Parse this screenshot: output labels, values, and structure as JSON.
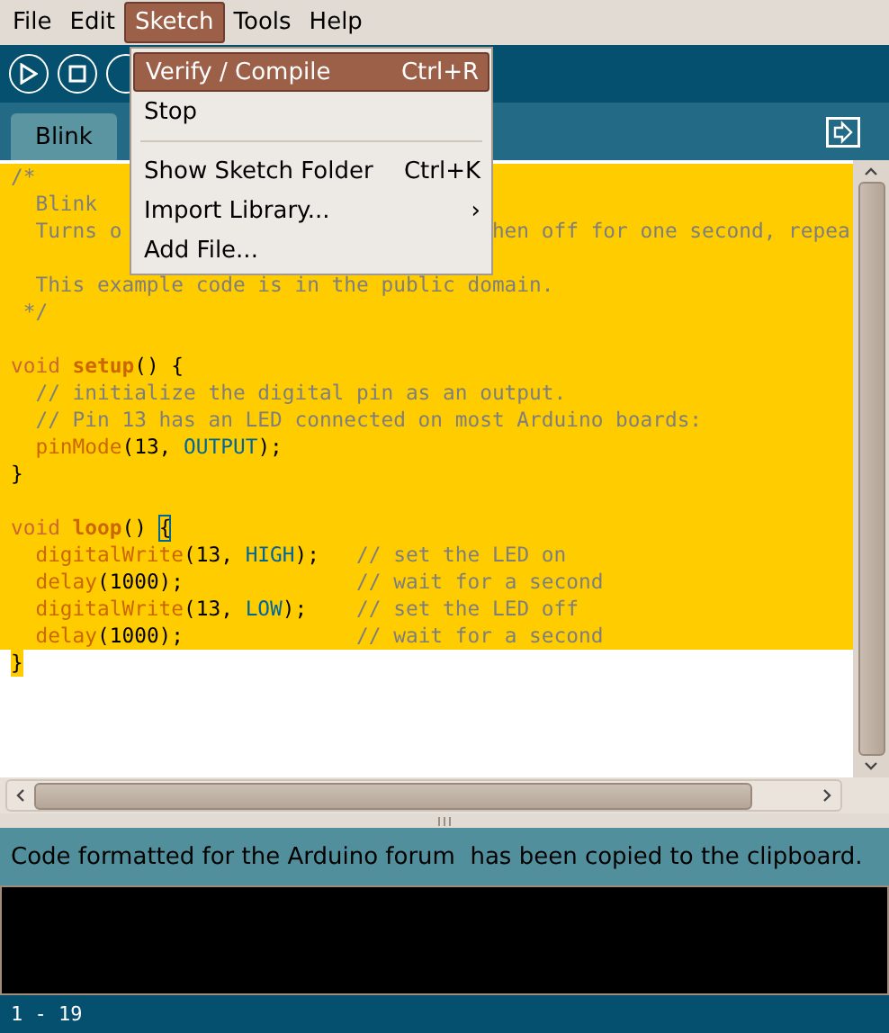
{
  "menubar": [
    {
      "label": "File",
      "selected": false
    },
    {
      "label": "Edit",
      "selected": false
    },
    {
      "label": "Sketch",
      "selected": true
    },
    {
      "label": "Tools",
      "selected": false
    },
    {
      "label": "Help",
      "selected": false
    }
  ],
  "menu": {
    "items": [
      {
        "kind": "item",
        "label": "Verify / Compile",
        "shortcut": "Ctrl+R",
        "selected": true
      },
      {
        "kind": "item",
        "label": "Stop",
        "selected": false
      },
      {
        "kind": "separator"
      },
      {
        "kind": "item",
        "label": "Show Sketch Folder",
        "shortcut": "Ctrl+K",
        "selected": false
      },
      {
        "kind": "submenu",
        "label": "Import Library...",
        "arrow": "›",
        "selected": false
      },
      {
        "kind": "item",
        "label": "Add File...",
        "selected": false
      }
    ]
  },
  "tabs": [
    {
      "label": "Blink",
      "selected": true
    }
  ],
  "editor": {
    "lines": [
      {
        "selected": true,
        "tokens": [
          {
            "kind": "comment",
            "text": "/*"
          }
        ]
      },
      {
        "selected": true,
        "tokens": [
          {
            "kind": "comment",
            "text": "  Blink"
          }
        ]
      },
      {
        "selected": true,
        "tokens": [
          {
            "kind": "comment",
            "text": "  Turns o"
          }
        ],
        "tail": {
          "kind": "comment",
          "text": "hen off for one second, repea"
        }
      },
      {
        "selected": true
      },
      {
        "selected": true,
        "tokens": [
          {
            "kind": "comment",
            "text": "  This example code is in the public domain."
          }
        ]
      },
      {
        "selected": true,
        "tokens": [
          {
            "kind": "comment",
            "text": " */"
          }
        ]
      },
      {
        "selected": true
      },
      {
        "selected": true,
        "tokens": [
          {
            "kind": "keyword",
            "text": "void "
          },
          {
            "kind": "function",
            "text": "setup"
          },
          {
            "kind": "plain",
            "text": "() {"
          }
        ]
      },
      {
        "selected": true,
        "tokens": [
          {
            "kind": "comment",
            "text": "  // initialize the digital pin as an output."
          }
        ]
      },
      {
        "selected": true,
        "tokens": [
          {
            "kind": "comment",
            "text": "  // Pin 13 has an LED connected on most Arduino boards:"
          }
        ]
      },
      {
        "selected": true,
        "tokens": [
          {
            "kind": "builtin",
            "text": "  pinMode"
          },
          {
            "kind": "plain",
            "text": "(13, "
          },
          {
            "kind": "constant",
            "text": "OUTPUT"
          },
          {
            "kind": "plain",
            "text": ");"
          }
        ]
      },
      {
        "selected": true,
        "tokens": [
          {
            "kind": "plain",
            "text": "}"
          }
        ]
      },
      {
        "selected": true
      },
      {
        "selected": true,
        "tokens": [
          {
            "kind": "keyword",
            "text": "void "
          },
          {
            "kind": "function",
            "text": "loop"
          },
          {
            "kind": "plain",
            "text": "() "
          },
          {
            "kind": "plain",
            "text": "{",
            "matched": true
          }
        ]
      },
      {
        "selected": true,
        "tokens": [
          {
            "kind": "builtin",
            "text": "  digitalWrite"
          },
          {
            "kind": "plain",
            "text": "(13, "
          },
          {
            "kind": "constant",
            "text": "HIGH"
          },
          {
            "kind": "plain",
            "text": ");   "
          },
          {
            "kind": "comment",
            "text": "// set the LED on"
          }
        ]
      },
      {
        "selected": true,
        "tokens": [
          {
            "kind": "builtin",
            "text": "  delay"
          },
          {
            "kind": "plain",
            "text": "(1000);              "
          },
          {
            "kind": "comment",
            "text": "// wait for a second"
          }
        ]
      },
      {
        "selected": true,
        "tokens": [
          {
            "kind": "builtin",
            "text": "  digitalWrite"
          },
          {
            "kind": "plain",
            "text": "(13, "
          },
          {
            "kind": "constant",
            "text": "LOW"
          },
          {
            "kind": "plain",
            "text": ");    "
          },
          {
            "kind": "comment",
            "text": "// set the LED off"
          }
        ]
      },
      {
        "selected": true,
        "tokens": [
          {
            "kind": "builtin",
            "text": "  delay"
          },
          {
            "kind": "plain",
            "text": "(1000);              "
          },
          {
            "kind": "comment",
            "text": "// wait for a second"
          }
        ]
      },
      {
        "selected": false,
        "tokens": [
          {
            "kind": "plain",
            "text": "}",
            "selected": true
          }
        ]
      }
    ]
  },
  "status": "Code formatted for the Arduino forum  has been copied to the clipboard.",
  "line_info": "1 - 19"
}
